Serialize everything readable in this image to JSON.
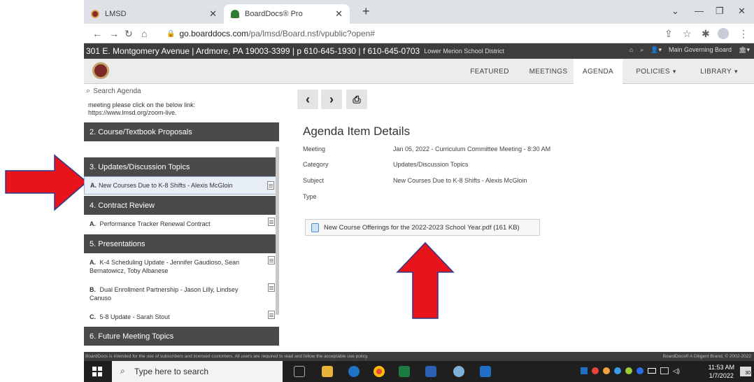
{
  "browser": {
    "tabs": [
      {
        "label": "LMSD"
      },
      {
        "label": "BoardDocs® Pro"
      }
    ],
    "new_tab": "+",
    "url_host": "go.boarddocs.com",
    "url_path": "/pa/lmsd/Board.nsf/vpublic?open#"
  },
  "site": {
    "address": "301 E. Montgomery Avenue | Ardmore, PA 19003-3399 | p 610-645-1930 | f 610-645-0703",
    "district": "Lower Merion School District",
    "board": "Main Governing Board",
    "nav": [
      "FEATURED",
      "MEETINGS",
      "AGENDA",
      "POLICIES",
      "LIBRARY"
    ]
  },
  "sidebar": {
    "search_placeholder": "Search Agenda",
    "zoom_text": "meeting please click on the below link: https://www.lmsd.org/zoom-live.",
    "sections": [
      "2. Course/Textbook Proposals",
      "3. Updates/Discussion Topics",
      "4. Contract Review",
      "5. Presentations",
      "6. Future Meeting Topics"
    ],
    "items": [
      {
        "letter": "A.",
        "text": "New Courses Due to K-8 Shifts - Alexis McGloin"
      },
      {
        "letter": "A.",
        "text": "Performance Tracker Renewal Contract"
      },
      {
        "letter": "A.",
        "text": "K-4 Scheduling Update - Jennifer Gaudioso, Sean Bernatowicz, Toby Albanese"
      },
      {
        "letter": "B.",
        "text": "Dual Enrollment Partnership - Jason Lilly, Lindsey Canuso"
      },
      {
        "letter": "C.",
        "text": "5-8 Update - Sarah Stout"
      }
    ]
  },
  "details": {
    "title": "Agenda Item Details",
    "rows": [
      {
        "label": "Meeting",
        "value": "Jan 05, 2022 - Curriculum Committee Meeting - 8:30 AM"
      },
      {
        "label": "Category",
        "value": "Updates/Discussion Topics"
      },
      {
        "label": "Subject",
        "value": "New Courses Due to K-8 Shifts - Alexis McGloin"
      },
      {
        "label": "Type",
        "value": ""
      }
    ],
    "attachment": "New Course Offerings for the 2022-2023 School Year.pdf (161 KB)"
  },
  "footer": {
    "left": "BoardDocs is intended for the use of subscribers and licensed customers. All users are required to read and follow the acceptable use policy.",
    "right": "BoardDocs® A Diligent Brand, © 2002-2022"
  },
  "taskbar": {
    "search": "Type here to search",
    "time": "11:53 AM",
    "date": "1/7/2022",
    "notifications": "30"
  },
  "colors": {
    "annotation_arrow": "#e8141a",
    "header_dark": "#3d3d3d",
    "section_bg": "#4a4a4a"
  }
}
